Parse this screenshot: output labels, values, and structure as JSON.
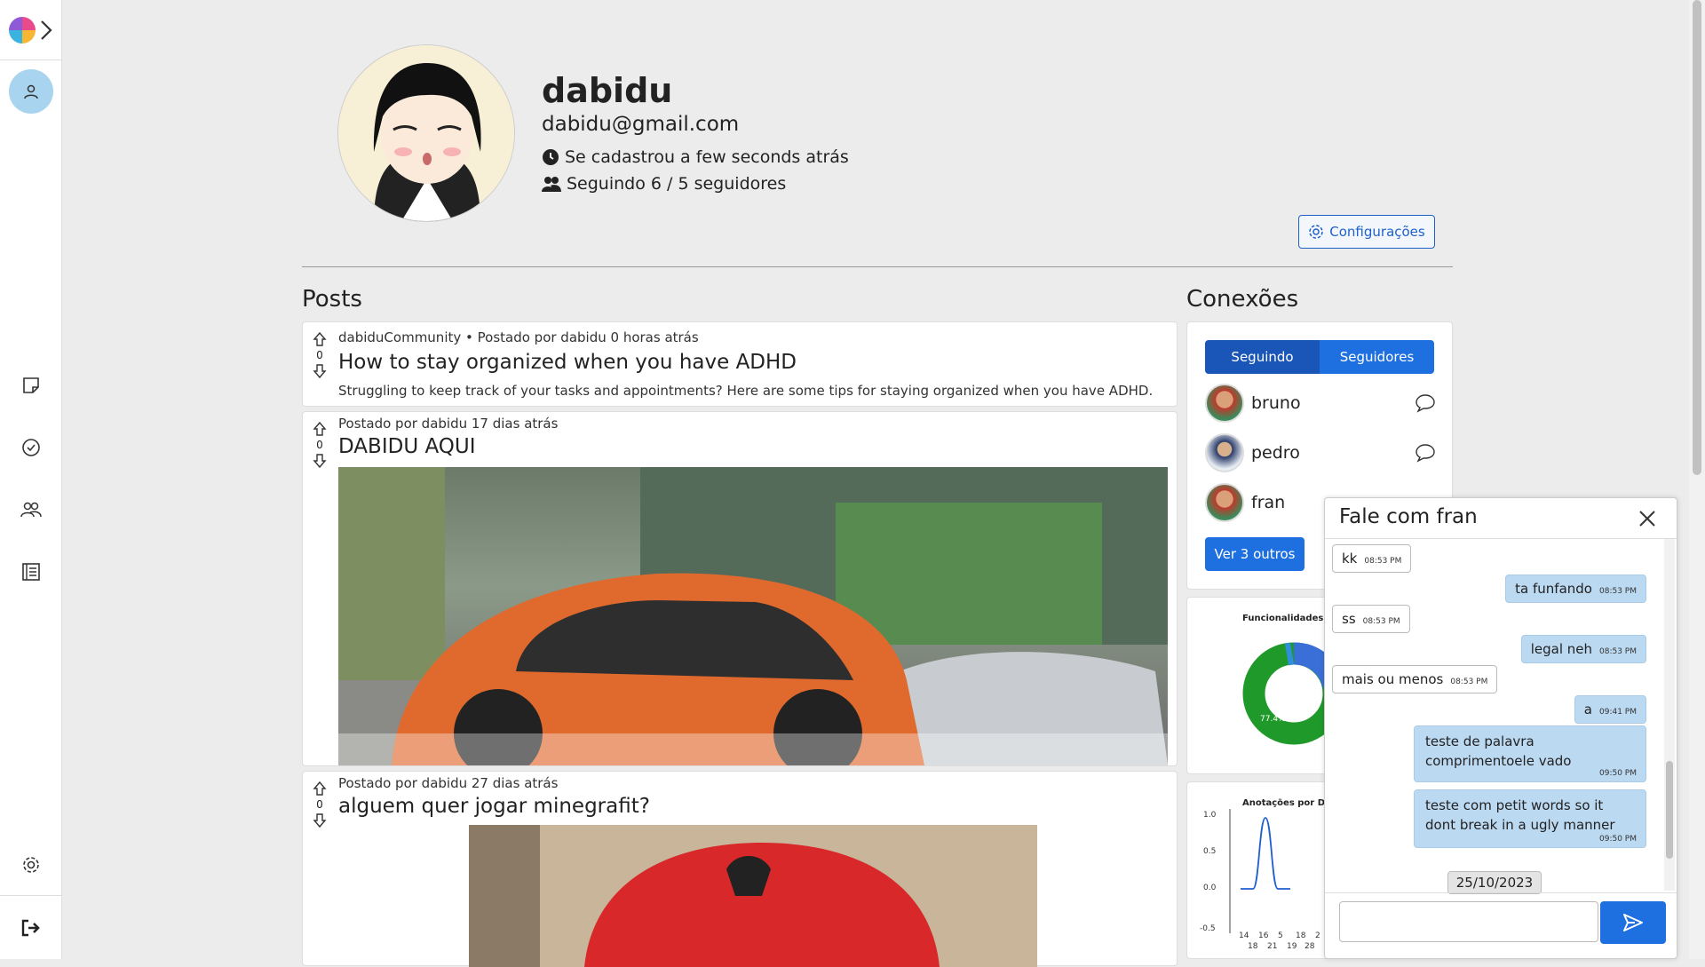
{
  "profile": {
    "name": "dabidu",
    "email": "dabidu@gmail.com",
    "joined": "Se cadastrou a few seconds atrás",
    "follow": "Seguindo 6 / 5 seguidores",
    "config_label": "Configurações"
  },
  "posts_title": "Posts",
  "posts": [
    {
      "meta": "dabiduCommunity • Postado por dabidu 0 horas atrás",
      "title": "How to stay organized when you have ADHD",
      "body": "Struggling to keep track of your tasks and appointments? Here are some tips for staying organized when you have ADHD.",
      "votes": "0"
    },
    {
      "meta": "Postado por dabidu 17 dias atrás",
      "title": "DABIDU AQUI",
      "votes": "0"
    },
    {
      "meta": "Postado por dabidu 27 dias atrás",
      "title": "alguem quer jogar minegrafit?",
      "votes": "0"
    }
  ],
  "connections": {
    "title": "Conexões",
    "tabs": [
      "Seguindo",
      "Seguidores"
    ],
    "people": [
      {
        "name": "bruno"
      },
      {
        "name": "pedro"
      },
      {
        "name": "fran"
      }
    ],
    "more_label": "Ver 3 outros"
  },
  "chart1": {
    "title": "Funcionalidades mai",
    "pct": "77.4%"
  },
  "chart_data": {
    "type": "line",
    "title": "Anotações por Dia",
    "x": [
      "14",
      "16",
      "5",
      "18",
      "2",
      "18",
      "21",
      "19",
      "28"
    ],
    "y_ticks": [
      "1.0",
      "0.5",
      "0.0",
      "-0.5"
    ],
    "ylim": [
      -0.5,
      1.0
    ],
    "series": [
      {
        "values": [
          0,
          0,
          1,
          0,
          0
        ]
      }
    ]
  },
  "chat": {
    "title": "Fale com fran",
    "messages": [
      {
        "text": "kk",
        "time": "08:53 PM",
        "side": "in"
      },
      {
        "text": "ta funfando",
        "time": "08:53 PM",
        "side": "out"
      },
      {
        "text": "ss",
        "time": "08:53 PM",
        "side": "in"
      },
      {
        "text": "legal neh",
        "time": "08:53 PM",
        "side": "out"
      },
      {
        "text": "mais ou menos",
        "time": "08:53 PM",
        "side": "in"
      },
      {
        "text": "a",
        "time": "09:41 PM",
        "side": "out"
      },
      {
        "text": "teste de palavra comprimentoele vado",
        "time": "09:50 PM",
        "side": "out"
      },
      {
        "text": "teste com petit words so it dont break in a ugly manner",
        "time": "09:50 PM",
        "side": "out"
      }
    ],
    "date": "25/10/2023"
  },
  "colors": {
    "accent": "#1e6fe0",
    "sidebar_active": "#a9d4ef",
    "bubble_out": "#bcd9f2"
  }
}
